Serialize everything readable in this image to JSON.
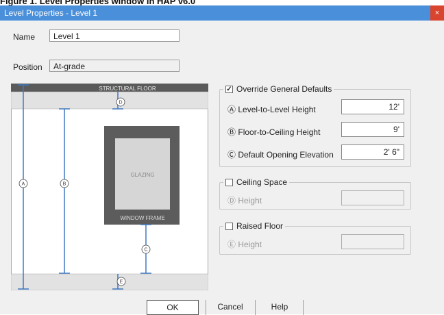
{
  "caption": "Figure 1. Level Properties window in HAP v6.0",
  "window": {
    "title": "Level Properties - Level 1",
    "close_glyph": "×"
  },
  "name": {
    "label": "Name",
    "value": "Level 1"
  },
  "position": {
    "label": "Position",
    "value": "At-grade"
  },
  "diagram": {
    "structural_floor": "STRUCTURAL FLOOR",
    "glazing": "GLAZING",
    "window_frame": "WINDOW FRAME",
    "markers": {
      "a": "A",
      "b": "B",
      "c": "C",
      "d": "D",
      "e": "E"
    }
  },
  "override": {
    "label": "Override General Defaults",
    "checked": true,
    "rows": [
      {
        "symbol": "Ⓐ",
        "label": "Level-to-Level Height",
        "value": "12'"
      },
      {
        "symbol": "Ⓑ",
        "label": "Floor-to-Ceiling Height",
        "value": "9'"
      },
      {
        "symbol": "Ⓒ",
        "label": "Default Opening Elevation",
        "value": "2' 6\""
      }
    ]
  },
  "ceiling_space": {
    "label": "Ceiling Space",
    "checked": false,
    "symbol": "Ⓓ",
    "height_label": "Height",
    "value": ""
  },
  "raised_floor": {
    "label": "Raised Floor",
    "checked": false,
    "symbol": "Ⓔ",
    "height_label": "Height",
    "value": ""
  },
  "buttons": {
    "ok": "OK",
    "cancel": "Cancel",
    "help": "Help"
  },
  "colors": {
    "titlebar": "#4a8fd9",
    "close": "#d9442f",
    "dimension_lines": "#3f78bf",
    "frame": "#555555"
  }
}
